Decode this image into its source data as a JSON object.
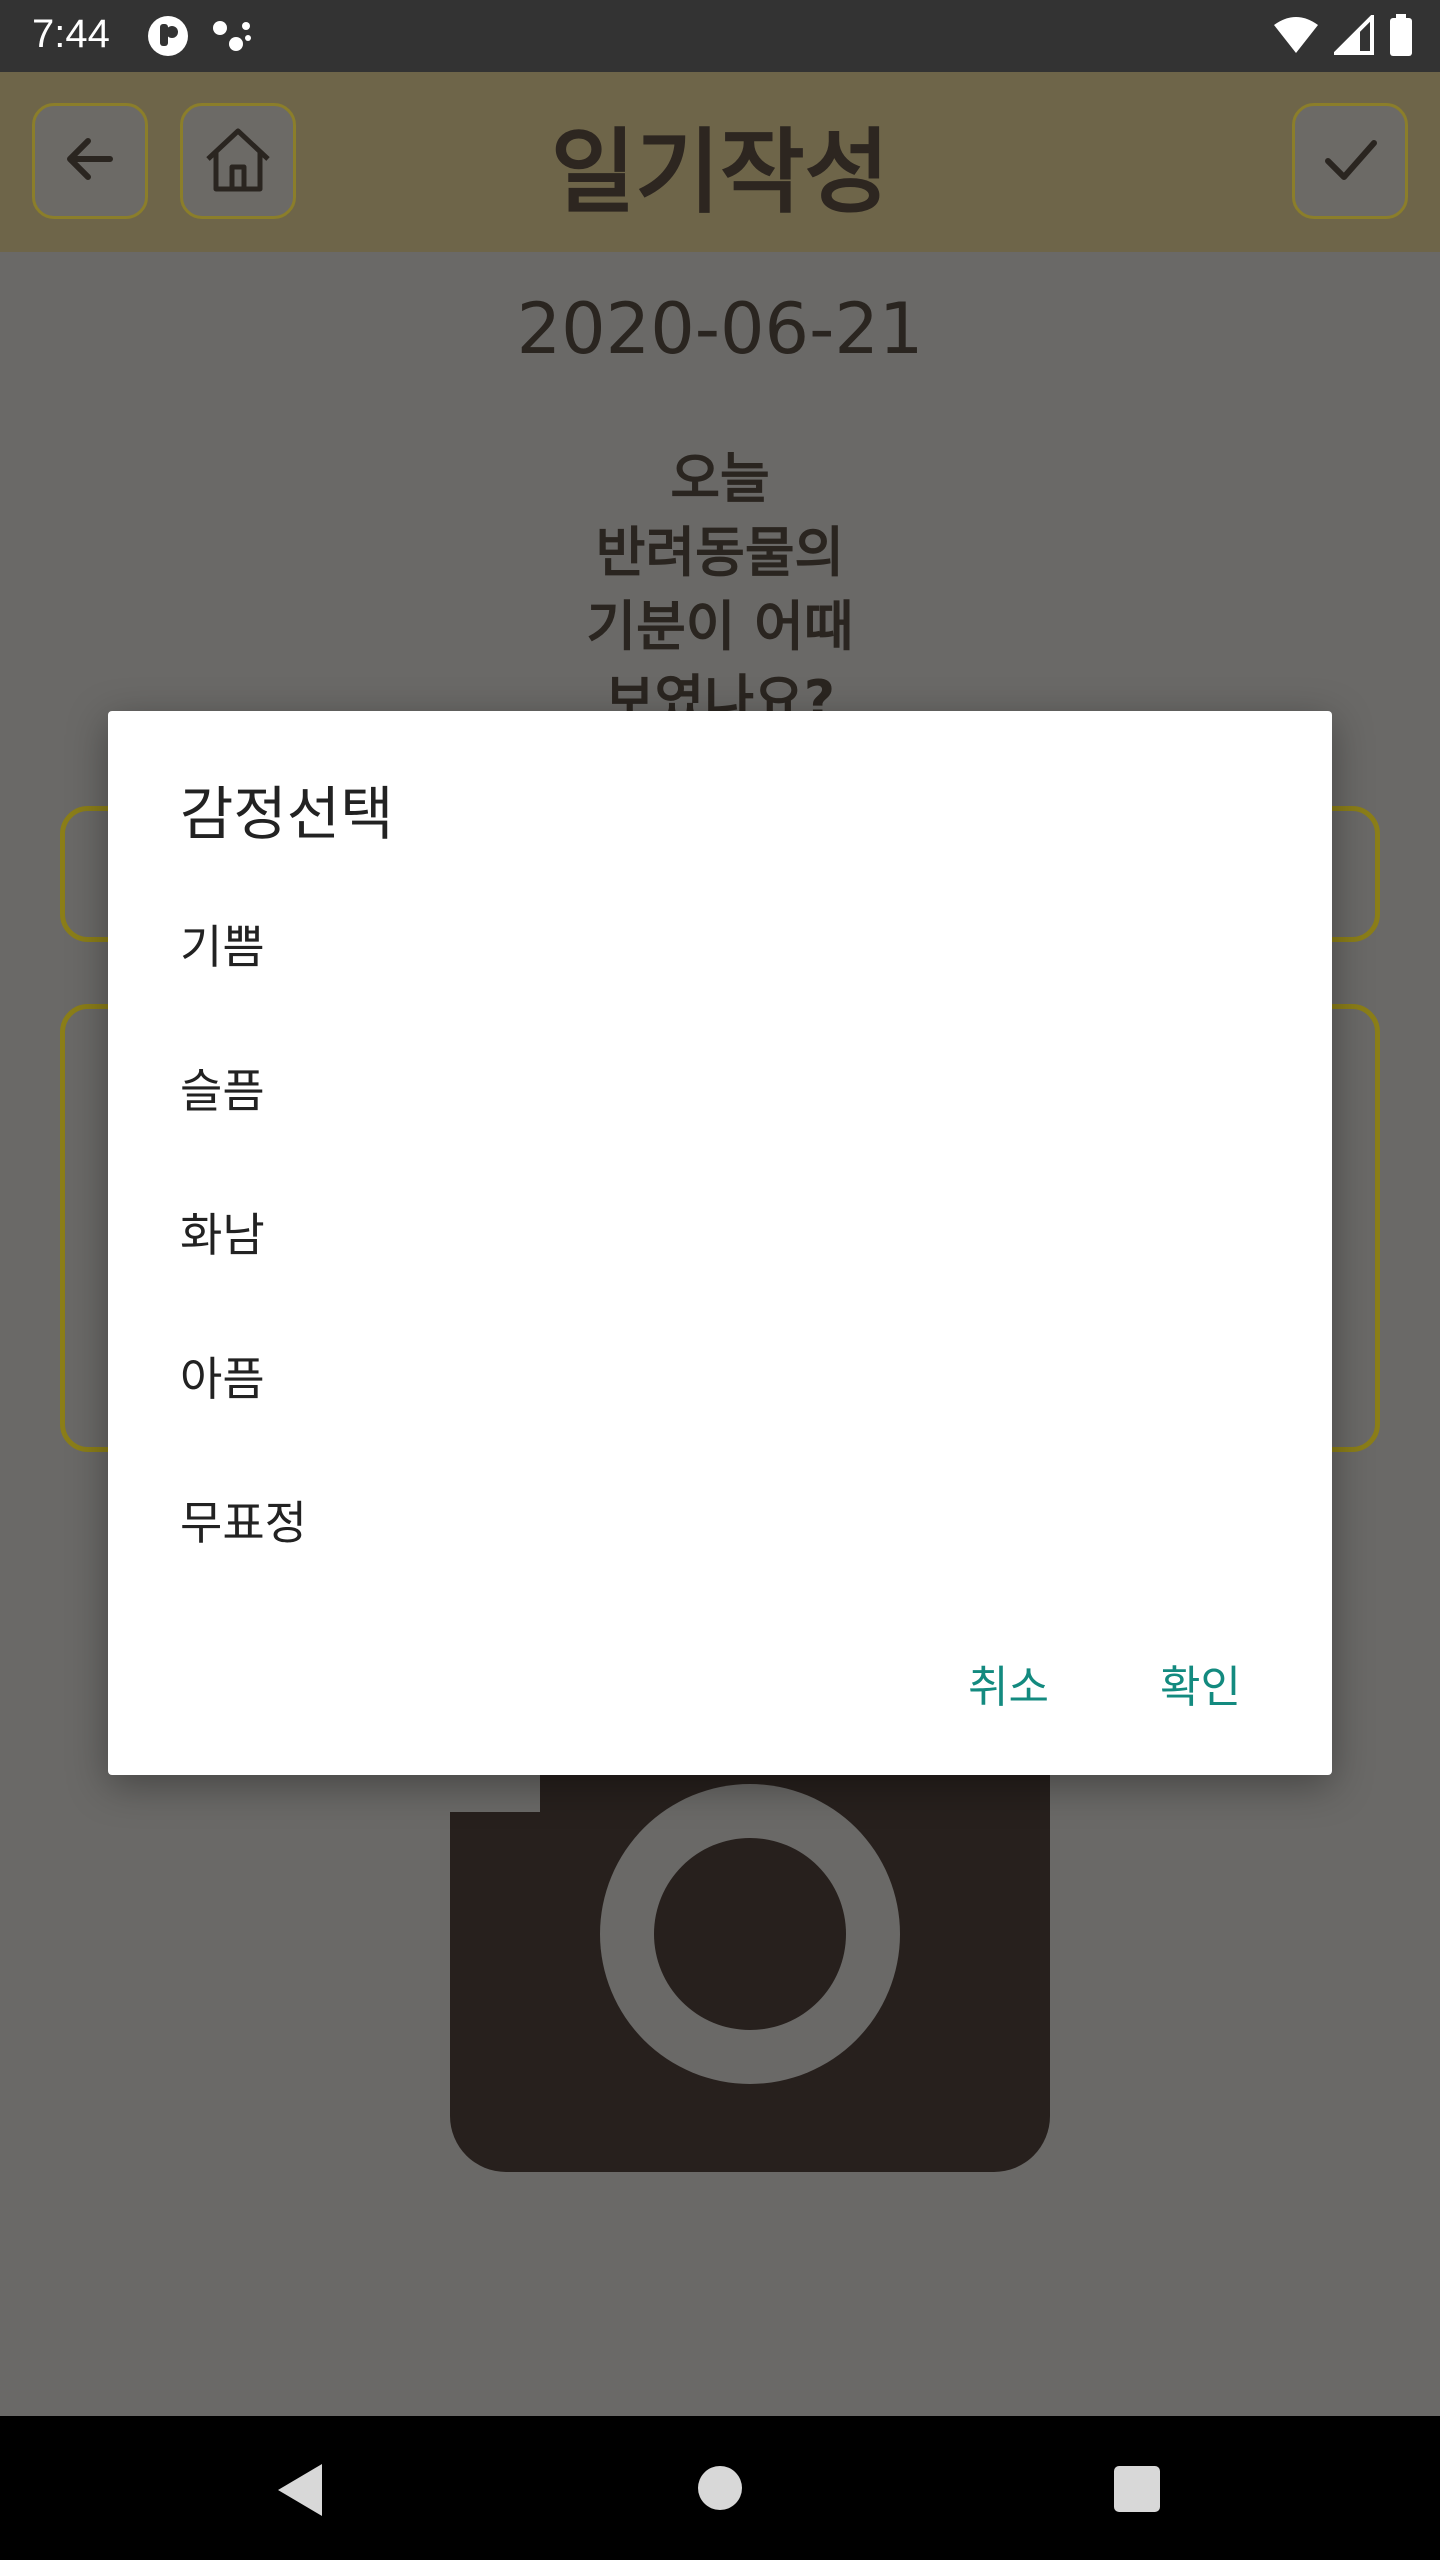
{
  "status_bar": {
    "time": "7:44",
    "left_icons": [
      "notification-app-icon",
      "notification-dots-icon"
    ],
    "right_icons": [
      "wifi-icon",
      "signal-icon",
      "battery-icon"
    ]
  },
  "app_bar": {
    "title": "일기작성",
    "back_icon": "arrow-left-icon",
    "home_icon": "home-icon",
    "confirm_icon": "check-icon",
    "border_color": "#8b7e2a"
  },
  "content": {
    "date": "2020-06-21",
    "question_lines": [
      "오늘",
      "반려동물의",
      "기분이 어때",
      "보였나요?"
    ]
  },
  "dialog": {
    "title": "감정선택",
    "options": [
      "기쁨",
      "슬픔",
      "화남",
      "아픔",
      "무표정"
    ],
    "cancel_label": "취소",
    "ok_label": "확인",
    "accent_color": "#138a7f"
  },
  "nav_bar": {
    "back": "nav-back-icon",
    "home": "nav-home-icon",
    "recents": "nav-recents-icon"
  }
}
